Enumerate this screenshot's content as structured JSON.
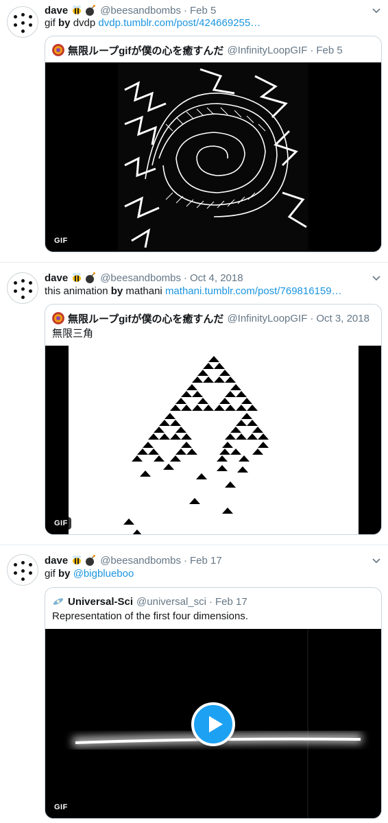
{
  "tweets": [
    {
      "author": {
        "name": "dave",
        "emoji": [
          "bee-icon",
          "bomb-icon"
        ],
        "handle": "@beesandbombs"
      },
      "sep": "·",
      "time": "Feb 5",
      "text": {
        "before": "gif ",
        "bold": "by",
        "after": " dvdp ",
        "link": "dvdp.tumblr.com/post/424669255…"
      },
      "quote": {
        "name": "無限ループgifが僕の心を癒すんだ",
        "handle": "@InfinityLoopGIF",
        "sep": "·",
        "time": "Feb 5",
        "text": "",
        "media_badge": "GIF"
      }
    },
    {
      "author": {
        "name": "dave",
        "emoji": [
          "bee-icon",
          "bomb-icon"
        ],
        "handle": "@beesandbombs"
      },
      "sep": "·",
      "time": "Oct 4, 2018",
      "text": {
        "before": "this animation ",
        "bold": "by",
        "after": " mathani ",
        "link": "mathani.tumblr.com/post/769816159…"
      },
      "quote": {
        "name": "無限ループgifが僕の心を癒すんだ",
        "handle": "@InfinityLoopGIF",
        "sep": "·",
        "time": "Oct 3, 2018",
        "text": "無限三角",
        "media_badge": "GIF"
      }
    },
    {
      "author": {
        "name": "dave",
        "emoji": [
          "bee-icon",
          "bomb-icon"
        ],
        "handle": "@beesandbombs"
      },
      "sep": "·",
      "time": "Feb 17",
      "text": {
        "before": "gif ",
        "bold": "by",
        "after": " ",
        "link": "@bigblueboo"
      },
      "quote": {
        "name": "Universal-Sci",
        "handle": "@universal_sci",
        "sep": "·",
        "time": "Feb 17",
        "text": "Representation of the first four dimensions.",
        "media_badge": "GIF"
      }
    }
  ],
  "colors": {
    "link": "#1b95e0",
    "muted": "#657786",
    "border": "#e6ecf0",
    "play": "#1da1f2"
  }
}
